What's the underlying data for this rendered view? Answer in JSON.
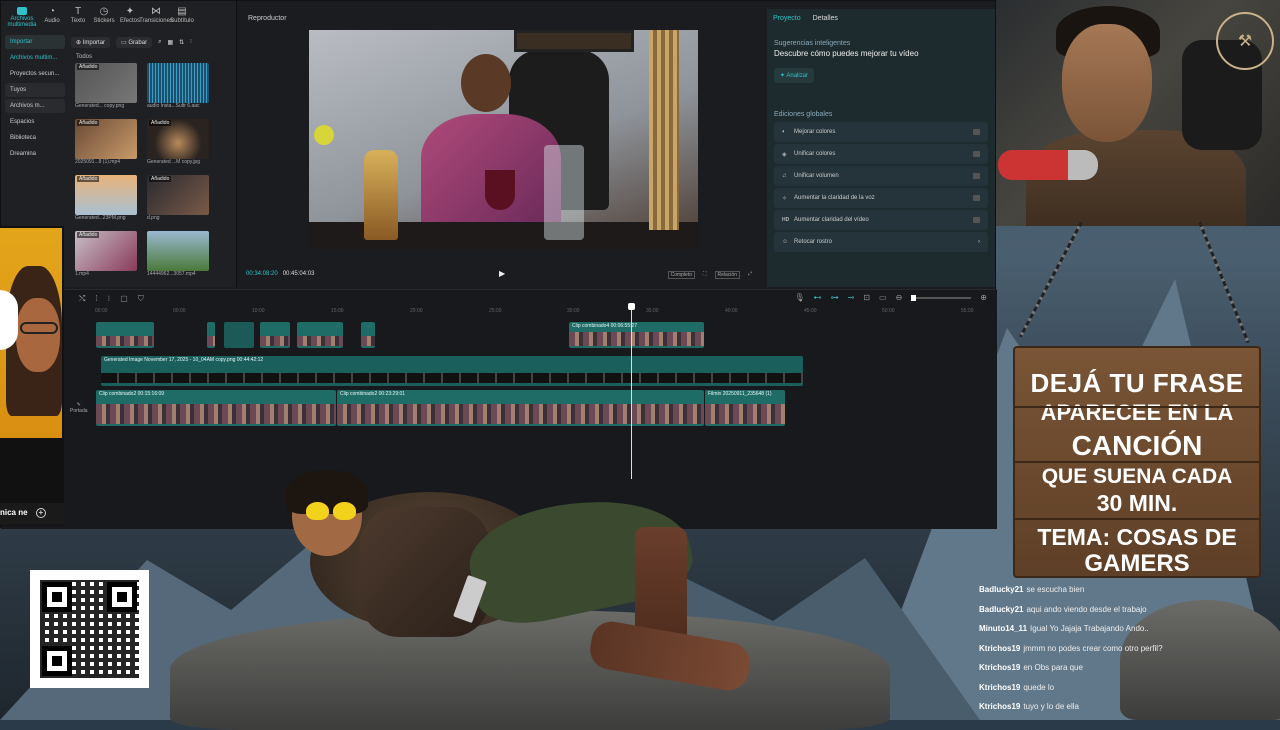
{
  "editor": {
    "tooltabs": [
      {
        "label": "Archivos multimedia",
        "icon": "media-icon"
      },
      {
        "label": "Audio",
        "icon": "audio-icon"
      },
      {
        "label": "Texto",
        "icon": "text-icon"
      },
      {
        "label": "Stickers",
        "icon": "sticker-icon"
      },
      {
        "label": "Efectos",
        "icon": "effects-icon"
      },
      {
        "label": "Transiciones",
        "icon": "transition-icon"
      },
      {
        "label": "Subtítulo",
        "icon": "subtitle-icon"
      }
    ],
    "sidebar": [
      "Importar",
      "Archivos multim...",
      "Proyectos secun...",
      "Tuyos",
      "Archivos m...",
      "Espacios",
      "Biblioteca",
      "Dreamina"
    ],
    "library": {
      "import_label": "Importar",
      "record_label": "Grabar",
      "all_label": "Todos",
      "thumbs": [
        {
          "tag": "Añadido",
          "name": "Generated... copy.png"
        },
        {
          "tag": "",
          "name": "audio Insta...Sultr 6.aac"
        },
        {
          "tag": "Añadido",
          "name": "2025091...8 (1).mp4"
        },
        {
          "tag": "Añadido",
          "name": "Generated ...M copy.jpg"
        },
        {
          "tag": "Añadido",
          "name": "Generated...23PM.png"
        },
        {
          "tag": "Añadido",
          "name": "d.png"
        },
        {
          "tag": "Añadido",
          "name": "1.mp4"
        },
        {
          "tag": "",
          "name": "14444962...3057.mp4"
        }
      ]
    },
    "player": {
      "title": "Reproductor",
      "current_time": "00:34:08:20",
      "total_time": "00:45:04:03",
      "btn_complete": "Completo",
      "btn_ratio": "Relación"
    },
    "properties": {
      "tab_project": "Proyecto",
      "tab_details": "Detalles",
      "smart_heading": "Sugerencias inteligentes",
      "smart_title": "Descubre cómo puedes mejorar tu vídeo",
      "analyze_label": "Analizar",
      "global_heading": "Ediciones globales",
      "items": [
        {
          "icon": "palette-icon",
          "label": "Mejorar colores"
        },
        {
          "icon": "color-match-icon",
          "label": "Unificar colores"
        },
        {
          "icon": "volume-icon",
          "label": "Unificar volumen"
        },
        {
          "icon": "voice-icon",
          "label": "Aumentar la claridad de la voz"
        },
        {
          "icon": "hd-icon",
          "label": "Aumentar claridad del vídeo"
        },
        {
          "icon": "face-icon",
          "label": "Retocar rostro"
        }
      ]
    },
    "timeline": {
      "ruler": [
        "00:00",
        "00:00",
        "10:00",
        "15:00",
        "20:00",
        "25:00",
        "30:00",
        "35:00",
        "40:00",
        "45:00",
        "50:00",
        "55:00"
      ],
      "clip_top": "Clip combinado4  00:06:55:27",
      "clip_image": "Generated Image November 17, 2025 - 10_04AM copy.png  00:44:42:12",
      "clip_main1": "Clip combinado2  00:15:16:09",
      "clip_main2": "Clip combinado2  00:23:29:01",
      "clip_main3": "Filmin  20250911_235648 (1)",
      "cover_label": "Portada"
    }
  },
  "left_overlay": {
    "text": "nica ne"
  },
  "sign": {
    "lines": [
      "DEJÁ TU FRASE",
      "APARECEE EN LA",
      "CANCIÓN",
      "QUE SUENA CADA",
      "30 MIN.",
      "TEMA: COSAS DE",
      "GAMERS"
    ]
  },
  "chat": [
    {
      "user": "Badlucky21",
      "text": "se escucha bien"
    },
    {
      "user": "Badlucky21",
      "text": "aqui ando viendo desde el trabajo"
    },
    {
      "user": "Minuto14_11",
      "text": "Igual Yo Jajaja Trabajando Ando.."
    },
    {
      "user": "Ktrichos19",
      "text": "jmmm no podes crear como otro perfil?"
    },
    {
      "user": "Ktrichos19",
      "text": "en Obs para que"
    },
    {
      "user": "Ktrichos19",
      "text": "quede lo"
    },
    {
      "user": "Ktrichos19",
      "text": "tuyo y lo de ella"
    }
  ]
}
